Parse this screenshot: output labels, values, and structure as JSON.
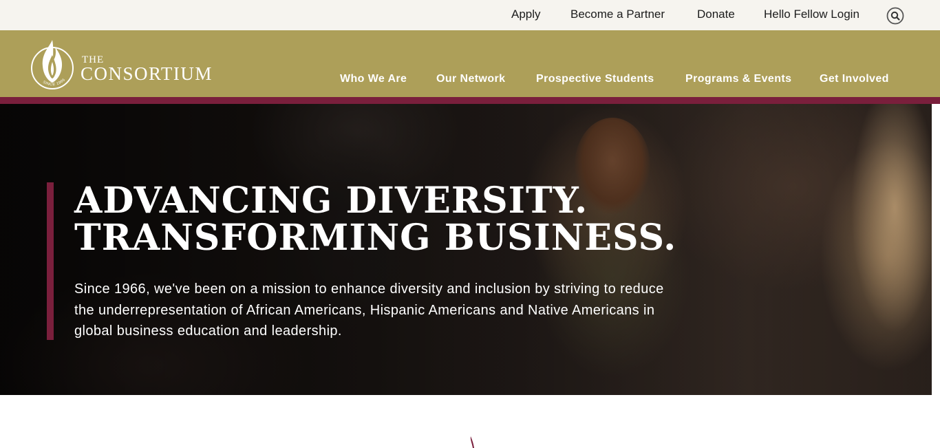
{
  "utility_nav": {
    "links": [
      "Apply",
      "Become a Partner",
      "Donate",
      "Hello Fellow Login"
    ],
    "search_icon": "search-icon"
  },
  "logo": {
    "the": "THE",
    "name": "CONSORTIUM",
    "emblem_text": "SINCE 1966",
    "emblem_icon": "flame-emblem-icon"
  },
  "main_nav": {
    "items": [
      "Who We Are",
      "Our Network",
      "Prospective Students",
      "Programs & Events",
      "Get Involved"
    ]
  },
  "hero": {
    "title_line1": "ADVANCING DIVERSITY.",
    "title_line2": "TRANSFORMING BUSINESS.",
    "text": "Since 1966, we've been on a mission to enhance diversity and inclusion by striving to reduce the underrepresentation of African Americans, Hispanic Americans and Native Americans in global business education and leadership."
  },
  "colors": {
    "utility_bg": "#f6f4ef",
    "nav_bg": "#ad9f59",
    "accent_maroon": "#7a1f3c",
    "text_white": "#ffffff",
    "text_dark": "#1c1c1c"
  }
}
